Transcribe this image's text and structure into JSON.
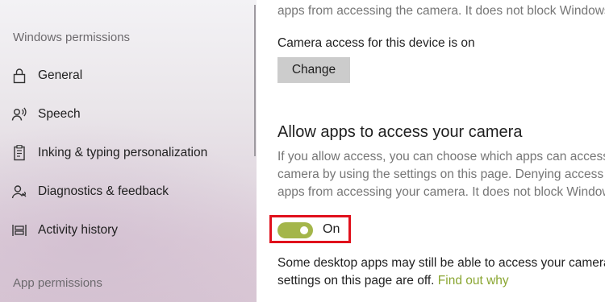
{
  "sidebar": {
    "windows_permissions_header": "Windows permissions",
    "items": [
      {
        "label": "General",
        "icon": "lock-icon"
      },
      {
        "label": "Speech",
        "icon": "speech-icon"
      },
      {
        "label": "Inking & typing personalization",
        "icon": "inking-icon"
      },
      {
        "label": "Diagnostics & feedback",
        "icon": "diagnostics-icon"
      },
      {
        "label": "Activity history",
        "icon": "activity-history-icon"
      }
    ],
    "app_permissions_header": "App permissions"
  },
  "main": {
    "top_partial_text": "apps from accessing the camera. It does not block Windows H",
    "device_access_status": "Camera access for this device is on",
    "change_button_label": "Change",
    "allow_apps_heading": "Allow apps to access your camera",
    "allow_apps_description_lines": [
      "If you allow access, you can choose which apps can access your",
      "camera by using the settings on this page. Denying access blo",
      "apps from accessing your camera. It does not block Windows H"
    ],
    "toggle": {
      "state": "On",
      "on": true,
      "color": "#a4b64a"
    },
    "desktop_apps_note_line1": "Some desktop apps may still be able to access your camera w",
    "desktop_apps_note_line2": "settings on this page are off.",
    "find_out_why_link": "Find out why"
  },
  "colors": {
    "accent": "#a4b64a",
    "link": "#8aa632",
    "highlight": "#e0101c"
  }
}
